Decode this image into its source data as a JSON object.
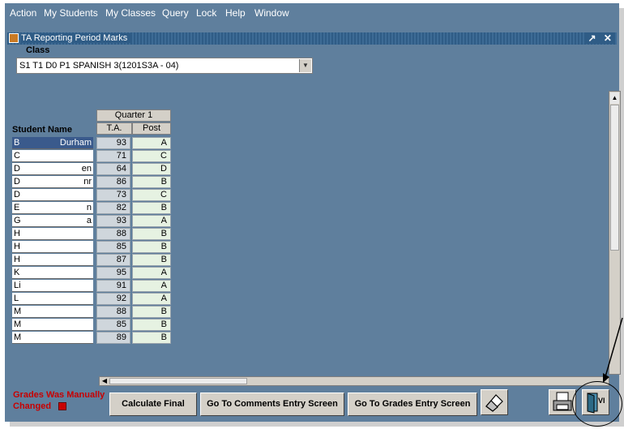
{
  "menubar": {
    "items": [
      "Action",
      "My Students",
      "My Classes",
      "Query",
      "Lock",
      "Help",
      "Window"
    ]
  },
  "window": {
    "title": "TA Reporting Period Marks",
    "controls": "↗ ✕"
  },
  "class_section": {
    "label": "Class",
    "selected_value": "S1 T1 D0 P1 SPANISH 3(1201S3A - 04)"
  },
  "grid": {
    "group_header": "Quarter 1",
    "name_header": "Student Name",
    "col_ta": "T.A.",
    "col_post": "Post",
    "rows": [
      {
        "name": "B",
        "name_tail": "Durham",
        "ta": "93",
        "post": "A"
      },
      {
        "name": "C",
        "name_tail": "",
        "ta": "71",
        "post": "C"
      },
      {
        "name": "D",
        "name_tail": "en",
        "ta": "64",
        "post": "D"
      },
      {
        "name": "D",
        "name_tail": "nr",
        "ta": "86",
        "post": "B"
      },
      {
        "name": "D",
        "name_tail": "",
        "ta": "73",
        "post": "C"
      },
      {
        "name": "E",
        "name_tail": "n",
        "ta": "82",
        "post": "B"
      },
      {
        "name": "G",
        "name_tail": "a",
        "ta": "93",
        "post": "A"
      },
      {
        "name": "H",
        "name_tail": "",
        "ta": "88",
        "post": "B"
      },
      {
        "name": "H",
        "name_tail": "",
        "ta": "85",
        "post": "B"
      },
      {
        "name": "H",
        "name_tail": "",
        "ta": "87",
        "post": "B"
      },
      {
        "name": "K",
        "name_tail": "",
        "ta": "95",
        "post": "A"
      },
      {
        "name": "Li",
        "name_tail": "",
        "ta": "91",
        "post": "A"
      },
      {
        "name": "L",
        "name_tail": "",
        "ta": "92",
        "post": "A"
      },
      {
        "name": "M",
        "name_tail": "",
        "ta": "88",
        "post": "B"
      },
      {
        "name": "M",
        "name_tail": "",
        "ta": "85",
        "post": "B"
      },
      {
        "name": "M",
        "name_tail": "",
        "ta": "89",
        "post": "B"
      }
    ]
  },
  "status": {
    "grades_note_line1": "Grades Was Manually",
    "grades_note_line2": "Changed"
  },
  "buttons": {
    "calculate": "Calculate Final",
    "comments": "Go To Comments Entry Screen",
    "grades": "Go To Grades Entry Screen"
  },
  "icons": {
    "eraser": "eraser-icon",
    "print": "printer-icon",
    "exit": "exit-door-icon"
  },
  "colors": {
    "background": "#5f7f9d",
    "warning": "#c80000"
  }
}
